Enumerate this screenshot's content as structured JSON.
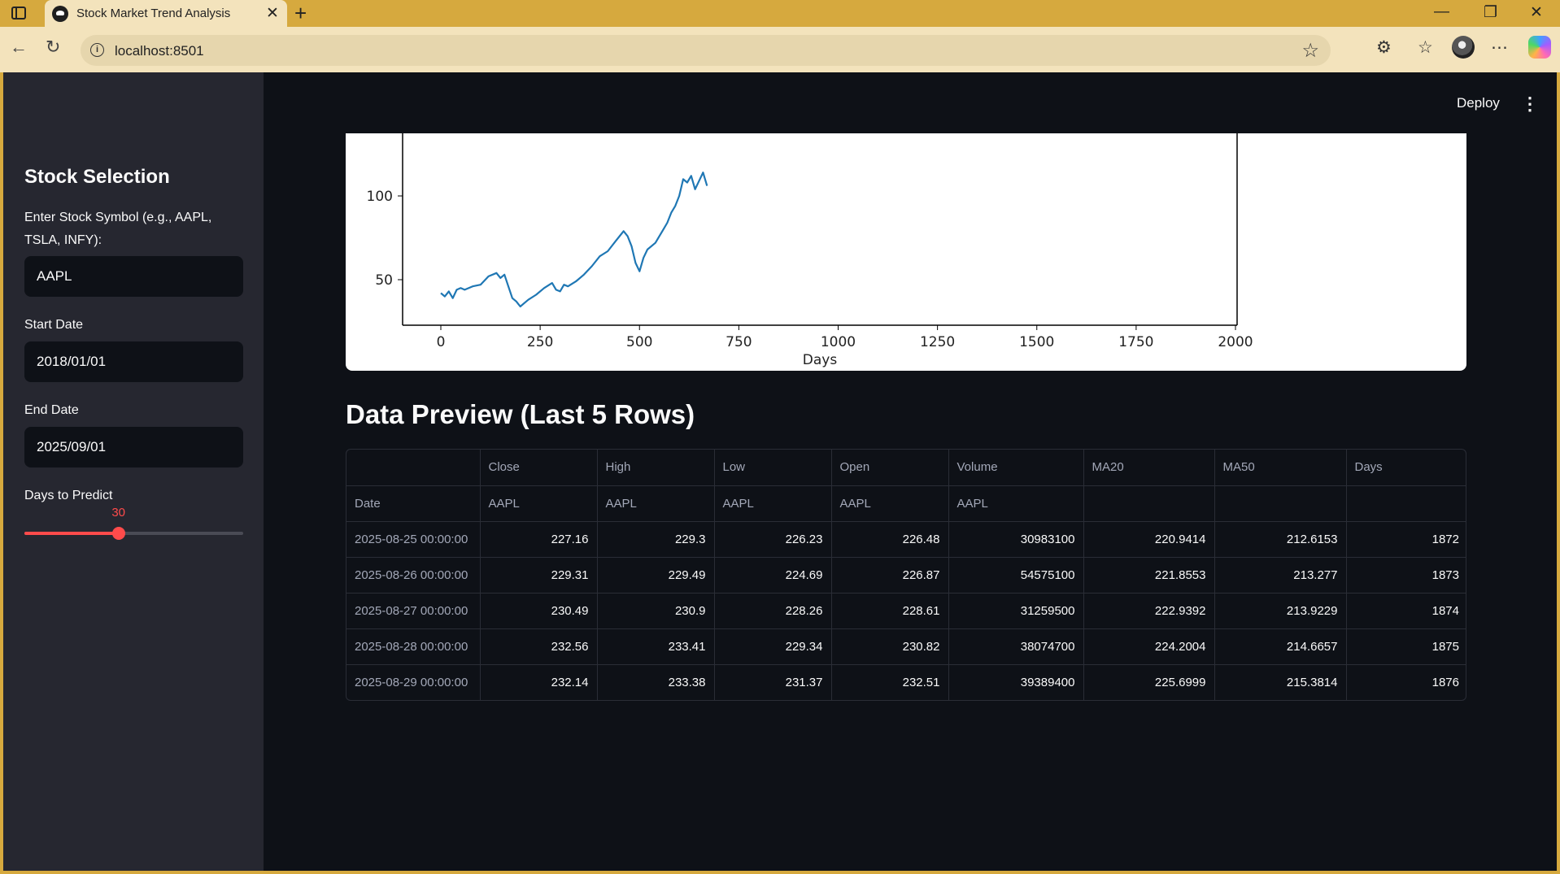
{
  "browser": {
    "tab_title": "Stock Market Trend Analysis",
    "url": "localhost:8501"
  },
  "sidebar": {
    "title": "Stock Selection",
    "symbol_label": "Enter Stock Symbol (e.g., AAPL, TSLA, INFY):",
    "symbol_value": "AAPL",
    "start_label": "Start Date",
    "start_value": "2018/01/01",
    "end_label": "End Date",
    "end_value": "2025/09/01",
    "predict_label": "Days to Predict",
    "predict_value": "30",
    "predict_fraction": 0.43
  },
  "header": {
    "deploy_label": "Deploy"
  },
  "chart_data": {
    "type": "line",
    "xlabel": "Days",
    "ylabel": "",
    "xlim": [
      -100,
      2000
    ],
    "ylim": [
      25,
      110
    ],
    "x_ticks": [
      "0",
      "250",
      "500",
      "750",
      "1000",
      "1250",
      "1500",
      "1750",
      "2000"
    ],
    "y_ticks": [
      "50",
      "100"
    ],
    "color": "#1f77b4",
    "series": [
      {
        "x": [
          0,
          10,
          20,
          30,
          40,
          50,
          60,
          80,
          100,
          120,
          140,
          150,
          160,
          170,
          180,
          190,
          200,
          210,
          220,
          240,
          260,
          280,
          290,
          300,
          310,
          320,
          340,
          360,
          380,
          400,
          420,
          440,
          460,
          470,
          480,
          490,
          500,
          510,
          520,
          540,
          560,
          570,
          580,
          590,
          600,
          610,
          620,
          630,
          640,
          660,
          670
        ],
        "y": [
          42,
          40,
          43,
          39,
          44,
          45,
          44,
          46,
          47,
          52,
          54,
          51,
          53,
          46,
          39,
          37,
          34,
          36,
          38,
          41,
          45,
          48,
          44,
          43,
          47,
          46,
          49,
          53,
          58,
          64,
          67,
          73,
          79,
          76,
          70,
          60,
          55,
          63,
          68,
          72,
          80,
          84,
          90,
          94,
          100,
          110,
          108,
          112,
          104,
          114,
          106
        ]
      }
    ]
  },
  "preview": {
    "title": "Data Preview (Last 5 Rows)",
    "columns": [
      "Close",
      "High",
      "Low",
      "Open",
      "Volume",
      "MA20",
      "MA50",
      "Days"
    ],
    "tickers": [
      "AAPL",
      "AAPL",
      "AAPL",
      "AAPL",
      "AAPL",
      "",
      "",
      ""
    ],
    "index_name": "Date",
    "rows": [
      [
        "2025-08-25 00:00:00",
        "227.16",
        "229.3",
        "226.23",
        "226.48",
        "30983100",
        "220.9414",
        "212.6153",
        "1872"
      ],
      [
        "2025-08-26 00:00:00",
        "229.31",
        "229.49",
        "224.69",
        "226.87",
        "54575100",
        "221.8553",
        "213.277",
        "1873"
      ],
      [
        "2025-08-27 00:00:00",
        "230.49",
        "230.9",
        "228.26",
        "228.61",
        "31259500",
        "222.9392",
        "213.9229",
        "1874"
      ],
      [
        "2025-08-28 00:00:00",
        "232.56",
        "233.41",
        "229.34",
        "230.82",
        "38074700",
        "224.2004",
        "214.6657",
        "1875"
      ],
      [
        "2025-08-29 00:00:00",
        "232.14",
        "233.38",
        "231.37",
        "232.51",
        "39389400",
        "225.6999",
        "215.3814",
        "1876"
      ]
    ]
  }
}
